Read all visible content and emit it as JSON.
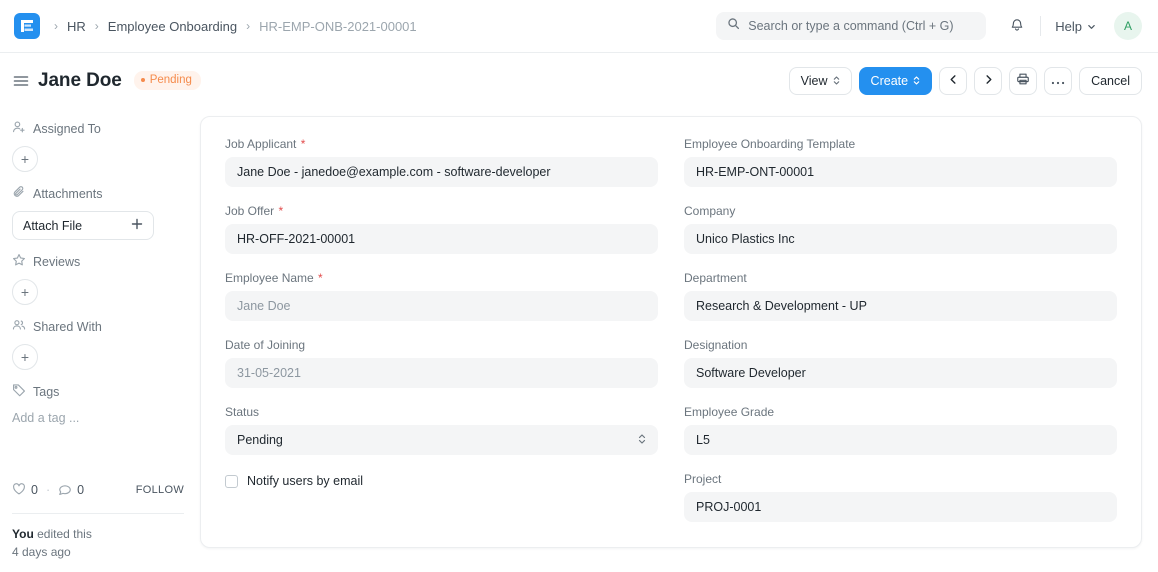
{
  "navbar": {
    "logo_icon": "erpnext-logo-icon",
    "breadcrumb": [
      {
        "label": "HR",
        "current": false
      },
      {
        "label": "Employee Onboarding",
        "current": false
      },
      {
        "label": "HR-EMP-ONB-2021-00001",
        "current": true
      }
    ],
    "search": {
      "icon": "search-icon",
      "placeholder": "Search or type a command (Ctrl + G)",
      "value": ""
    },
    "notifications_icon": "bell-icon",
    "help_label": "Help",
    "help_chevron_icon": "chevron-down-icon",
    "avatar_initial": "A"
  },
  "page_head": {
    "menu_icon": "hamburger-menu-icon",
    "title": "Jane Doe",
    "status_badge": "Pending",
    "toolbar": {
      "view_label": "View",
      "create_label": "Create",
      "prev_icon": "chevron-left-icon",
      "next_icon": "chevron-right-icon",
      "print_icon": "printer-icon",
      "more_icon": "ellipsis-icon",
      "cancel_label": "Cancel"
    }
  },
  "sidebar": {
    "assigned_to": {
      "label": "Assigned To",
      "icon": "user-plus-icon",
      "add_label": "+"
    },
    "attachments": {
      "label": "Attachments",
      "icon": "paperclip-icon",
      "button_label": "Attach File",
      "button_icon": "plus-icon"
    },
    "reviews": {
      "label": "Reviews",
      "icon": "star-icon",
      "add_label": "+"
    },
    "shared_with": {
      "label": "Shared With",
      "icon": "users-icon",
      "add_label": "+"
    },
    "tags": {
      "label": "Tags",
      "icon": "tag-icon",
      "placeholder": "Add a tag ..."
    },
    "stats": {
      "like_icon": "heart-icon",
      "like_count": "0",
      "separator": "·",
      "comment_icon": "comment-icon",
      "comment_count": "0",
      "follow_label": "FOLLOW"
    },
    "activity": {
      "actor": "You",
      "text": "edited this",
      "time": "4 days ago"
    }
  },
  "form": {
    "left_column": [
      {
        "label": "Job Applicant",
        "required": true,
        "value": "Jane Doe - janedoe@example.com - software-developer",
        "muted": false,
        "type": "link"
      },
      {
        "label": "Job Offer",
        "required": true,
        "value": "HR-OFF-2021-00001",
        "muted": false,
        "type": "link"
      },
      {
        "label": "Employee Name",
        "required": true,
        "value": "Jane Doe",
        "muted": true,
        "type": "data"
      },
      {
        "label": "Date of Joining",
        "required": false,
        "value": "31-05-2021",
        "muted": true,
        "type": "date"
      },
      {
        "label": "Status",
        "required": false,
        "value": "Pending",
        "muted": false,
        "type": "select"
      }
    ],
    "notify_checkbox": {
      "label": "Notify users by email",
      "checked": false
    },
    "right_column": [
      {
        "label": "Employee Onboarding Template",
        "required": false,
        "value": "HR-EMP-ONT-00001",
        "muted": false,
        "type": "link"
      },
      {
        "label": "Company",
        "required": false,
        "value": "Unico Plastics Inc",
        "muted": false,
        "type": "link"
      },
      {
        "label": "Department",
        "required": false,
        "value": "Research & Development - UP",
        "muted": false,
        "type": "link"
      },
      {
        "label": "Designation",
        "required": false,
        "value": "Software Developer",
        "muted": false,
        "type": "link"
      },
      {
        "label": "Employee Grade",
        "required": false,
        "value": "L5",
        "muted": false,
        "type": "link"
      },
      {
        "label": "Project",
        "required": false,
        "value": "PROJ-0001",
        "muted": false,
        "type": "link"
      }
    ]
  },
  "colors": {
    "brand_blue": "#2490EF",
    "status_orange": "#F58B4C",
    "status_orange_bg": "#FFF3EC",
    "avatar_green": "#2E9E62",
    "field_bg": "#F4F5F6",
    "required_red": "#E24C4C"
  }
}
